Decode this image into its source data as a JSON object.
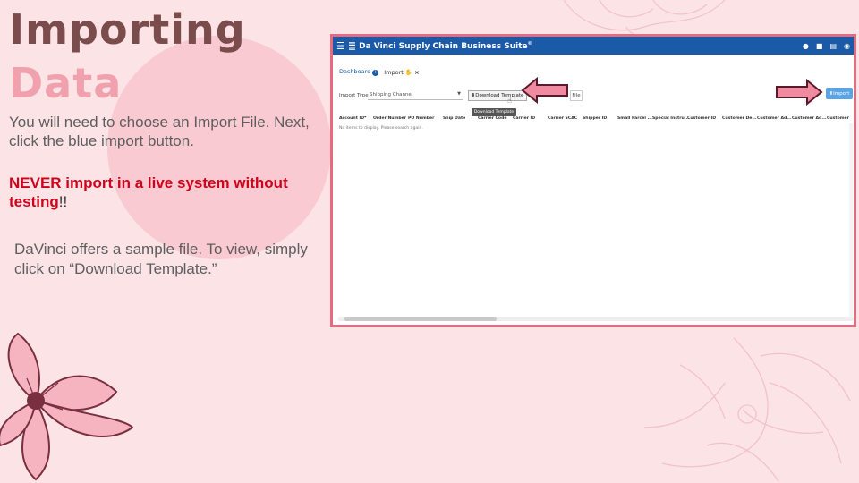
{
  "slide": {
    "title_line1": "Importing",
    "title_line2": "Data",
    "instructions": "You will need to choose an Import File. Next, click the blue import button.",
    "warning_bold": "NEVER import in a live system without testing",
    "warning_tail": "!!",
    "sample_note": "DaVinci offers a sample file. To view, simply click on “Download Template.”"
  },
  "app": {
    "suite_name": "Da Vinci Supply Chain Business Suite",
    "suite_mark": "©",
    "header_icons": [
      "user-icon",
      "building-icon",
      "printer-icon",
      "power-icon"
    ],
    "tabs": [
      {
        "label": "Dashboard",
        "icon": "info-icon"
      },
      {
        "label": "Import",
        "icon": "hand-icon",
        "close": "×"
      }
    ],
    "import_type_label": "Import Type",
    "import_type_value": "Shipping Channel",
    "download_template_label": "Download Template",
    "file_label": "File",
    "tooltip": "Download Template",
    "import_button_label": "Import",
    "columns": [
      "Account ID*",
      "Order Number",
      "PO Number",
      "Ship Date",
      "Carrier Code",
      "Carrier ID",
      "Carrier SCAC",
      "Shipper ID",
      "Small Parcel ...",
      "Special Instru...",
      "Customer ID",
      "Customer De...",
      "Customer Ad...",
      "Customer Ad...",
      "Customer"
    ],
    "empty_message": "No items to display. Please search again."
  },
  "colors": {
    "background": "#fbe3e6",
    "title_dark": "#7a4c4c",
    "title_pink": "#f0a1ad",
    "warning_red": "#d0021b",
    "app_header": "#1b5aa6",
    "import_button": "#5aa4e6",
    "arrow_fill": "#f08aa0",
    "frame_border": "#e46b80"
  }
}
